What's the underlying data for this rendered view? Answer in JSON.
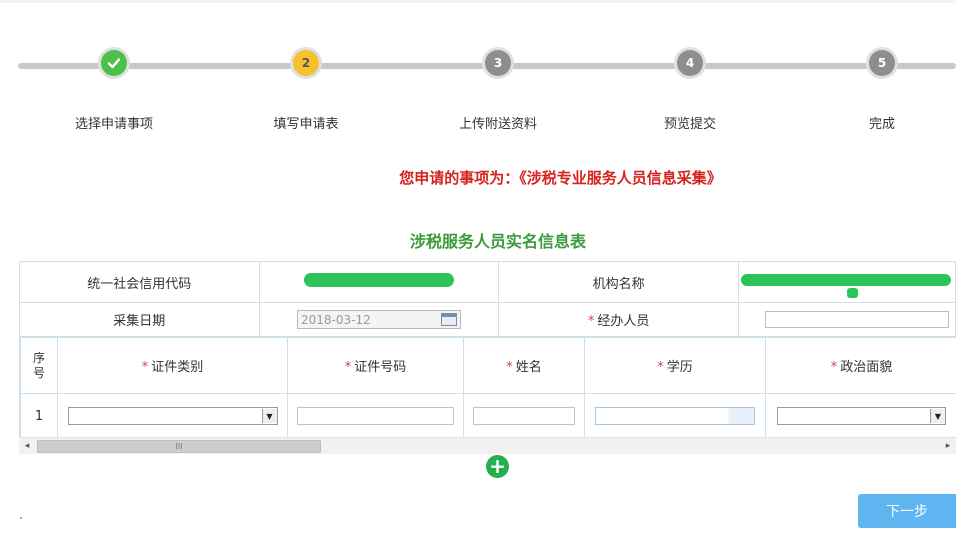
{
  "steps": [
    {
      "label": "选择申请事项",
      "marker": "",
      "state": "done"
    },
    {
      "label": "填写申请表",
      "marker": "2",
      "state": "current"
    },
    {
      "label": "上传附送资料",
      "marker": "3",
      "state": "todo"
    },
    {
      "label": "预览提交",
      "marker": "4",
      "state": "todo"
    },
    {
      "label": "完成",
      "marker": "5",
      "state": "todo"
    }
  ],
  "subject_line": "您申请的事项为：《涉税专业服务人员信息采集》",
  "form_title": "涉税服务人员实名信息表",
  "info": {
    "credit_code_label": "统一社会信用代码",
    "org_name_label": "机构名称",
    "collect_date_label": "采集日期",
    "collect_date_value": "2018-03-12",
    "handler_label": "经办人员",
    "handler_value": ""
  },
  "required_mark": "*",
  "grid": {
    "seq_header_1": "序",
    "seq_header_2": "号",
    "headers": [
      "证件类别",
      "证件号码",
      "姓名",
      "学历",
      "政治面貌"
    ],
    "rows": [
      {
        "seq": "1",
        "id_type": "",
        "id_number": "",
        "name": "",
        "education": "",
        "political_status": ""
      }
    ]
  },
  "scroll_grip": "III",
  "add_button": "+",
  "next_button": "下一步",
  "colors": {
    "accent_red": "#d4241e",
    "title_green": "#3c9a3c",
    "done_green": "#4cc149",
    "current_yellow": "#f5c12d",
    "todo_gray": "#8e8e8e",
    "button_blue": "#5fb5f0"
  }
}
